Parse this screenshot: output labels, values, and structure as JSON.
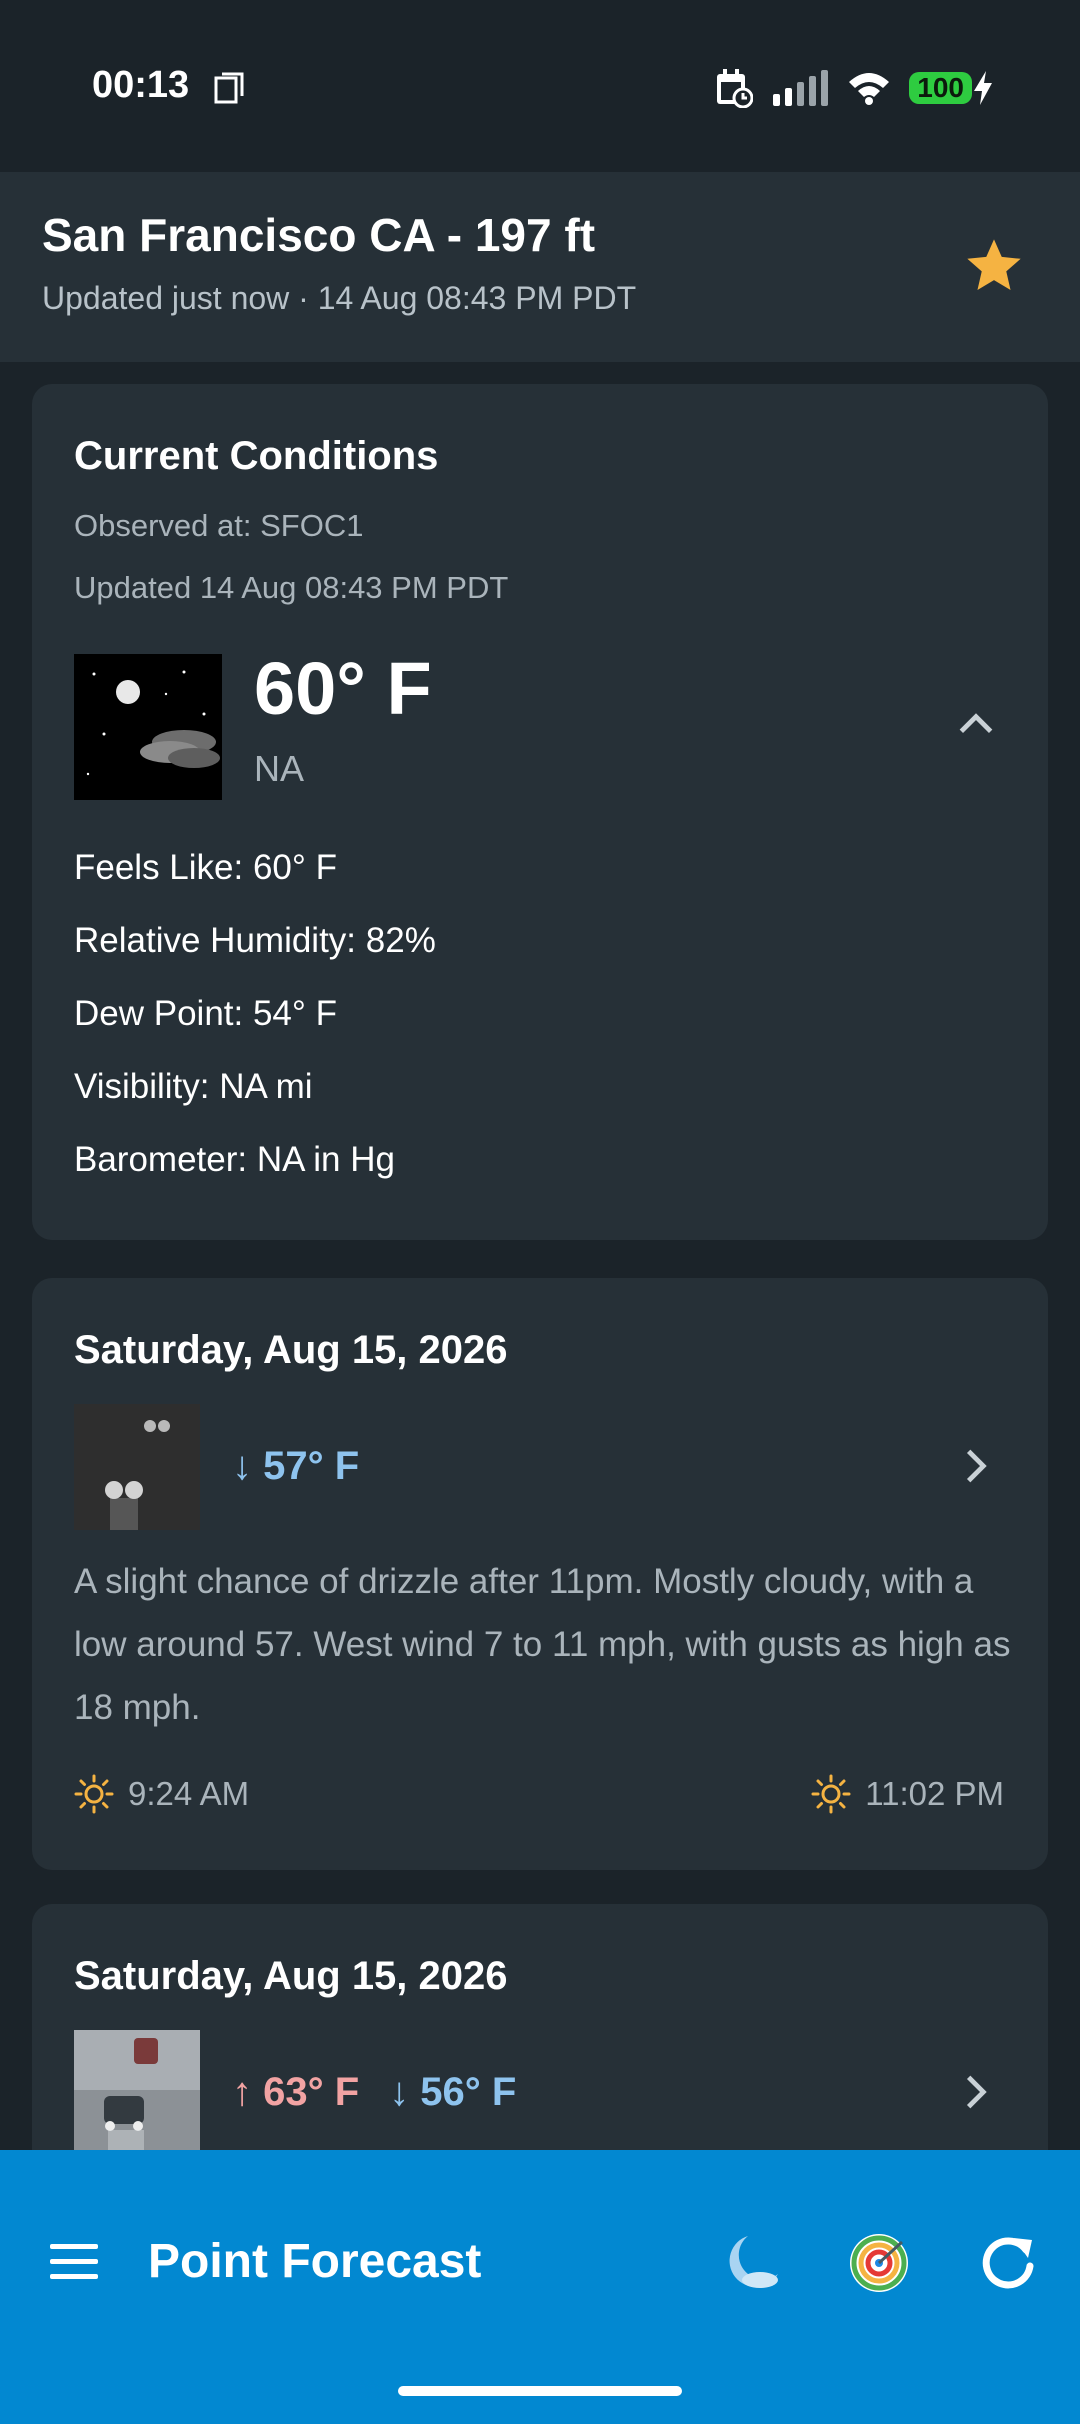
{
  "status_bar": {
    "time": "00:13",
    "battery": "100"
  },
  "header": {
    "location_title": "San Francisco CA - 197 ft",
    "updated": "Updated just now · 14 Aug 08:43 PM PDT"
  },
  "current_conditions": {
    "title": "Current Conditions",
    "observed_at": "Observed at: SFOC1",
    "updated": "Updated 14 Aug 08:43 PM PDT",
    "temperature": "60° F",
    "condition": "NA",
    "details": [
      "Feels Like: 60° F",
      "Relative Humidity: 82%",
      "Dew Point: 54° F",
      "Visibility: NA mi",
      "Barometer: NA in Hg"
    ]
  },
  "forecast": [
    {
      "date": "Saturday, Aug 15, 2026",
      "low": "↓ 57° F",
      "description": "A slight chance of drizzle after 11pm.  Mostly cloudy, with a low around 57. West wind 7 to 11 mph, with gusts as high as 18 mph.",
      "sunrise": "9:24 AM",
      "sunset": "11:02 PM"
    },
    {
      "date": "Saturday, Aug 15, 2026",
      "high": "↑ 63° F",
      "low": "↓ 56° F"
    }
  ],
  "bottom_bar": {
    "title": "Point Forecast"
  },
  "colors": {
    "background": "#1b2329",
    "card": "#263037",
    "accent_bar": "#0288d1",
    "star": "#f5b342",
    "low_temp": "#8ec3ee",
    "high_temp": "#f2a3a3"
  }
}
